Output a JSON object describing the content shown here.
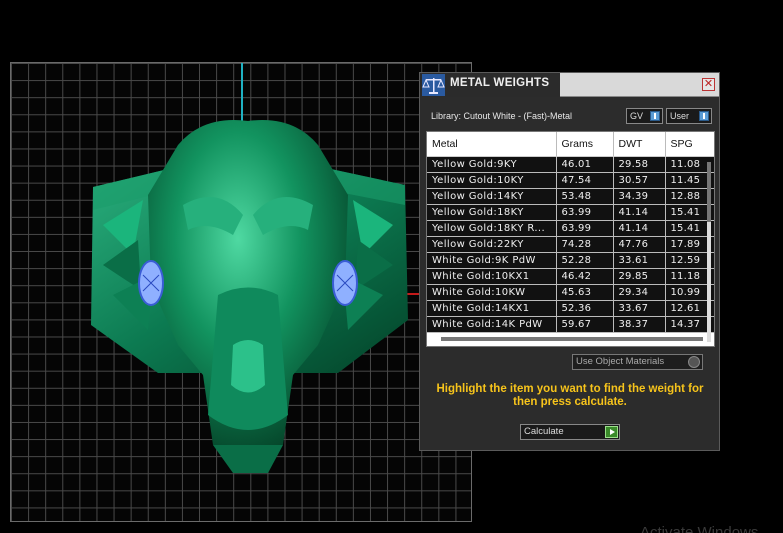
{
  "dialog": {
    "title": "METAL WEIGHTS",
    "close_symbol": "✕",
    "library_label": "Library: Cutout White - (Fast)-Metal",
    "gv_label": "GV",
    "user_label": "User",
    "columns": [
      "Metal",
      "Grams",
      "DWT",
      "SPG"
    ],
    "rows": [
      [
        "Yellow Gold:9KY",
        "46.01",
        "29.58",
        "11.08"
      ],
      [
        "Yellow Gold:10KY",
        "47.54",
        "30.57",
        "11.45"
      ],
      [
        "Yellow Gold:14KY",
        "53.48",
        "34.39",
        "12.88"
      ],
      [
        "Yellow Gold:18KY",
        "63.99",
        "41.14",
        "15.41"
      ],
      [
        "Yellow Gold:18KY R...",
        "63.99",
        "41.14",
        "15.41"
      ],
      [
        "Yellow Gold:22KY",
        "74.28",
        "47.76",
        "17.89"
      ],
      [
        "White Gold:9K PdW",
        "52.28",
        "33.61",
        "12.59"
      ],
      [
        "White Gold:10KX1",
        "46.42",
        "29.85",
        "11.18"
      ],
      [
        "White Gold:10KW",
        "45.63",
        "29.34",
        "10.99"
      ],
      [
        "White Gold:14KX1",
        "52.36",
        "33.67",
        "12.61"
      ],
      [
        "White Gold:14K PdW",
        "59.67",
        "38.37",
        "14.37"
      ]
    ],
    "use_object_materials": "Use Object Materials",
    "instructions": "Highlight the item you want to find the weight for then press calculate.",
    "calculate_label": "Calculate"
  },
  "watermark": "Activate Windows",
  "colors": {
    "model_green": "#0f8a5c",
    "accent_yellow": "#f7c41b",
    "axis_cyan": "#1fb2c4",
    "axis_red": "#c41a1a"
  }
}
